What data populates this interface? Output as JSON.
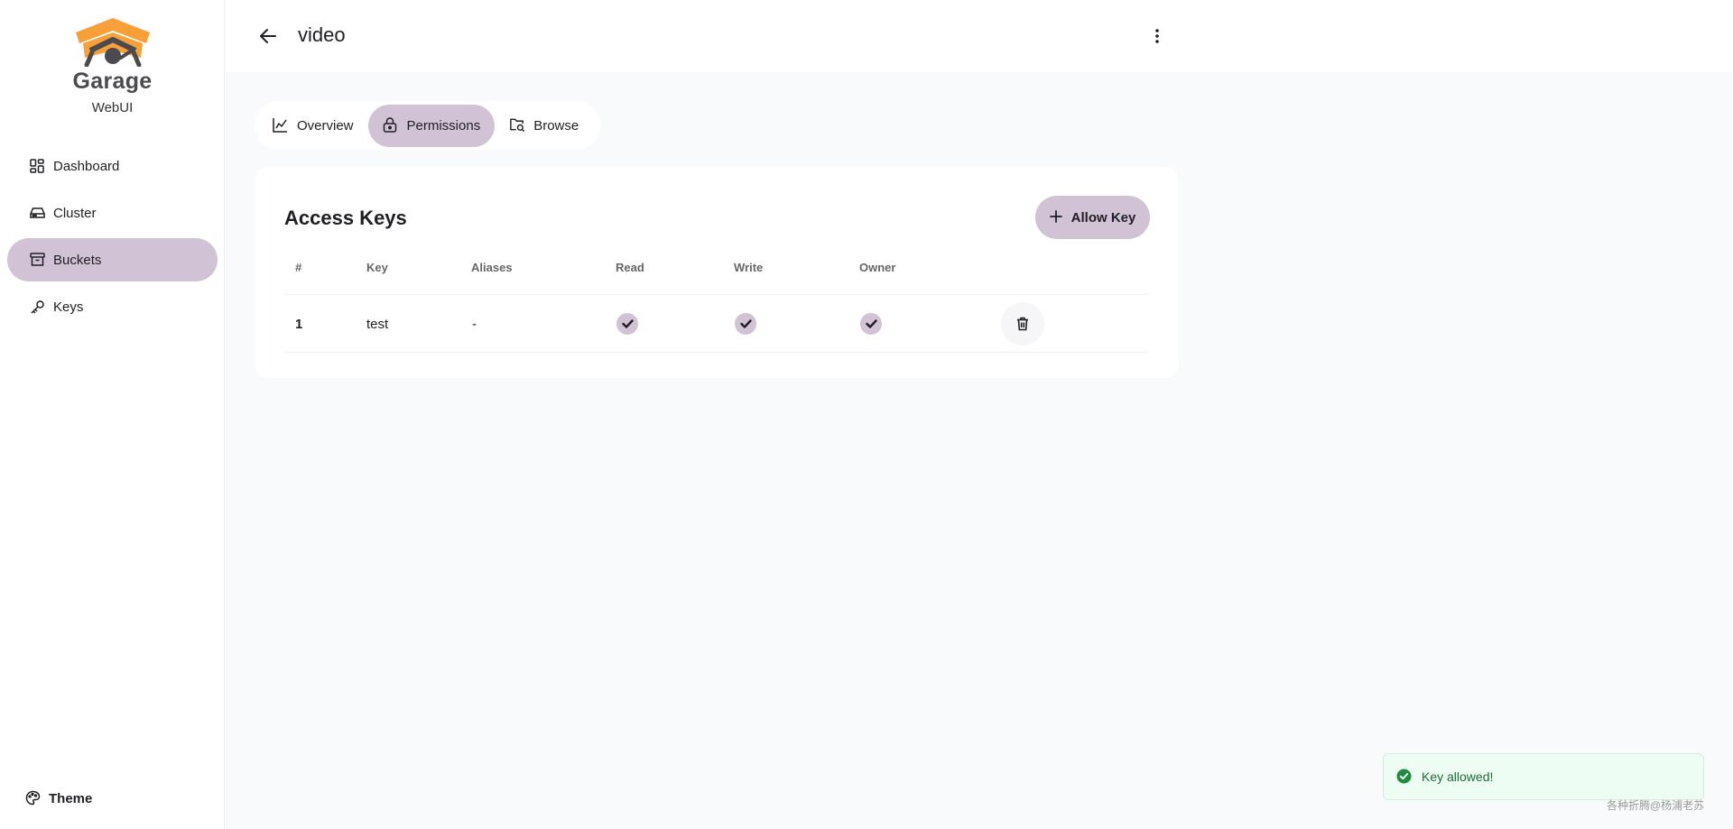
{
  "brand": {
    "name": "Garage",
    "subtitle": "WebUI"
  },
  "colors": {
    "accent": "#d1c2d6",
    "logo_orange": "#f7a03a",
    "logo_dark": "#4a4a4f",
    "success": "#1e8e3e"
  },
  "sidebar": {
    "items": [
      {
        "label": "Dashboard",
        "icon": "dashboard-icon",
        "active": false
      },
      {
        "label": "Cluster",
        "icon": "hard-drive-icon",
        "active": false
      },
      {
        "label": "Buckets",
        "icon": "archive-icon",
        "active": true
      },
      {
        "label": "Keys",
        "icon": "key-icon",
        "active": false
      }
    ],
    "theme_label": "Theme"
  },
  "header": {
    "title": "video"
  },
  "tabs": [
    {
      "label": "Overview",
      "icon": "chart-icon",
      "active": false
    },
    {
      "label": "Permissions",
      "icon": "lock-icon",
      "active": true
    },
    {
      "label": "Browse",
      "icon": "folder-search-icon",
      "active": false
    }
  ],
  "access_keys": {
    "title": "Access Keys",
    "allow_button": "Allow Key",
    "columns": [
      "#",
      "Key",
      "Aliases",
      "Read",
      "Write",
      "Owner"
    ],
    "rows": [
      {
        "index": "1",
        "key": "test",
        "aliases": "-",
        "read": true,
        "write": true,
        "owner": true
      }
    ]
  },
  "toast": {
    "message": "Key allowed!"
  },
  "watermark": "各种折腾@杨浦老苏"
}
